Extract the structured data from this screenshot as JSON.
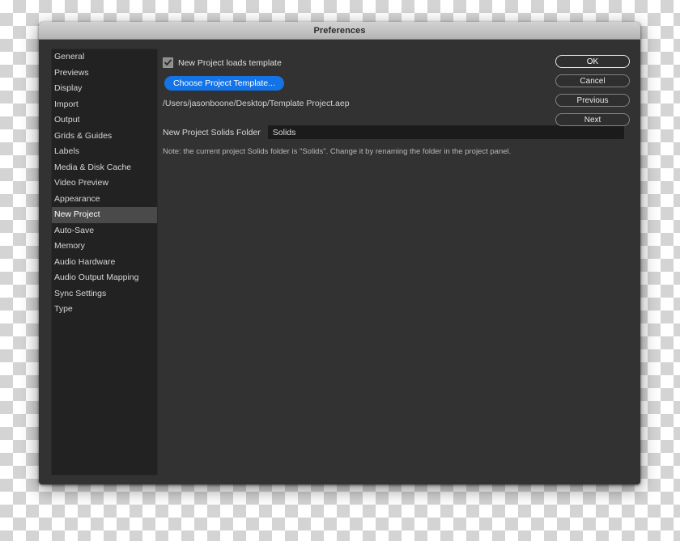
{
  "window": {
    "title": "Preferences"
  },
  "sidebar": {
    "items": [
      {
        "label": "General",
        "selected": false
      },
      {
        "label": "Previews",
        "selected": false
      },
      {
        "label": "Display",
        "selected": false
      },
      {
        "label": "Import",
        "selected": false
      },
      {
        "label": "Output",
        "selected": false
      },
      {
        "label": "Grids & Guides",
        "selected": false
      },
      {
        "label": "Labels",
        "selected": false
      },
      {
        "label": "Media & Disk Cache",
        "selected": false
      },
      {
        "label": "Video Preview",
        "selected": false
      },
      {
        "label": "Appearance",
        "selected": false
      },
      {
        "label": "New Project",
        "selected": true
      },
      {
        "label": "Auto-Save",
        "selected": false
      },
      {
        "label": "Memory",
        "selected": false
      },
      {
        "label": "Audio Hardware",
        "selected": false
      },
      {
        "label": "Audio Output Mapping",
        "selected": false
      },
      {
        "label": "Sync Settings",
        "selected": false
      },
      {
        "label": "Type",
        "selected": false
      }
    ]
  },
  "main": {
    "loads_template_checkbox": {
      "label": "New Project loads template",
      "checked": true
    },
    "choose_template_button": {
      "label": "Choose Project Template..."
    },
    "template_path": "/Users/jasonboone/Desktop/Template Project.aep",
    "solids_folder": {
      "label": "New Project Solids Folder",
      "value": "Solids",
      "placeholder": "Solids"
    },
    "solids_note": "Note: the current project Solids folder is \"Solids\". Change it by renaming the folder in the project panel."
  },
  "buttons": {
    "ok": "OK",
    "cancel": "Cancel",
    "previous": "Previous",
    "next": "Next"
  },
  "colors": {
    "accent_blue": "#1473e6",
    "dialog_bg": "#323232",
    "sidebar_bg": "#222222",
    "selected_item_bg": "#4a4a4a",
    "titlebar_bg": "#c2c2c2",
    "input_bg": "#1b1b1b"
  }
}
